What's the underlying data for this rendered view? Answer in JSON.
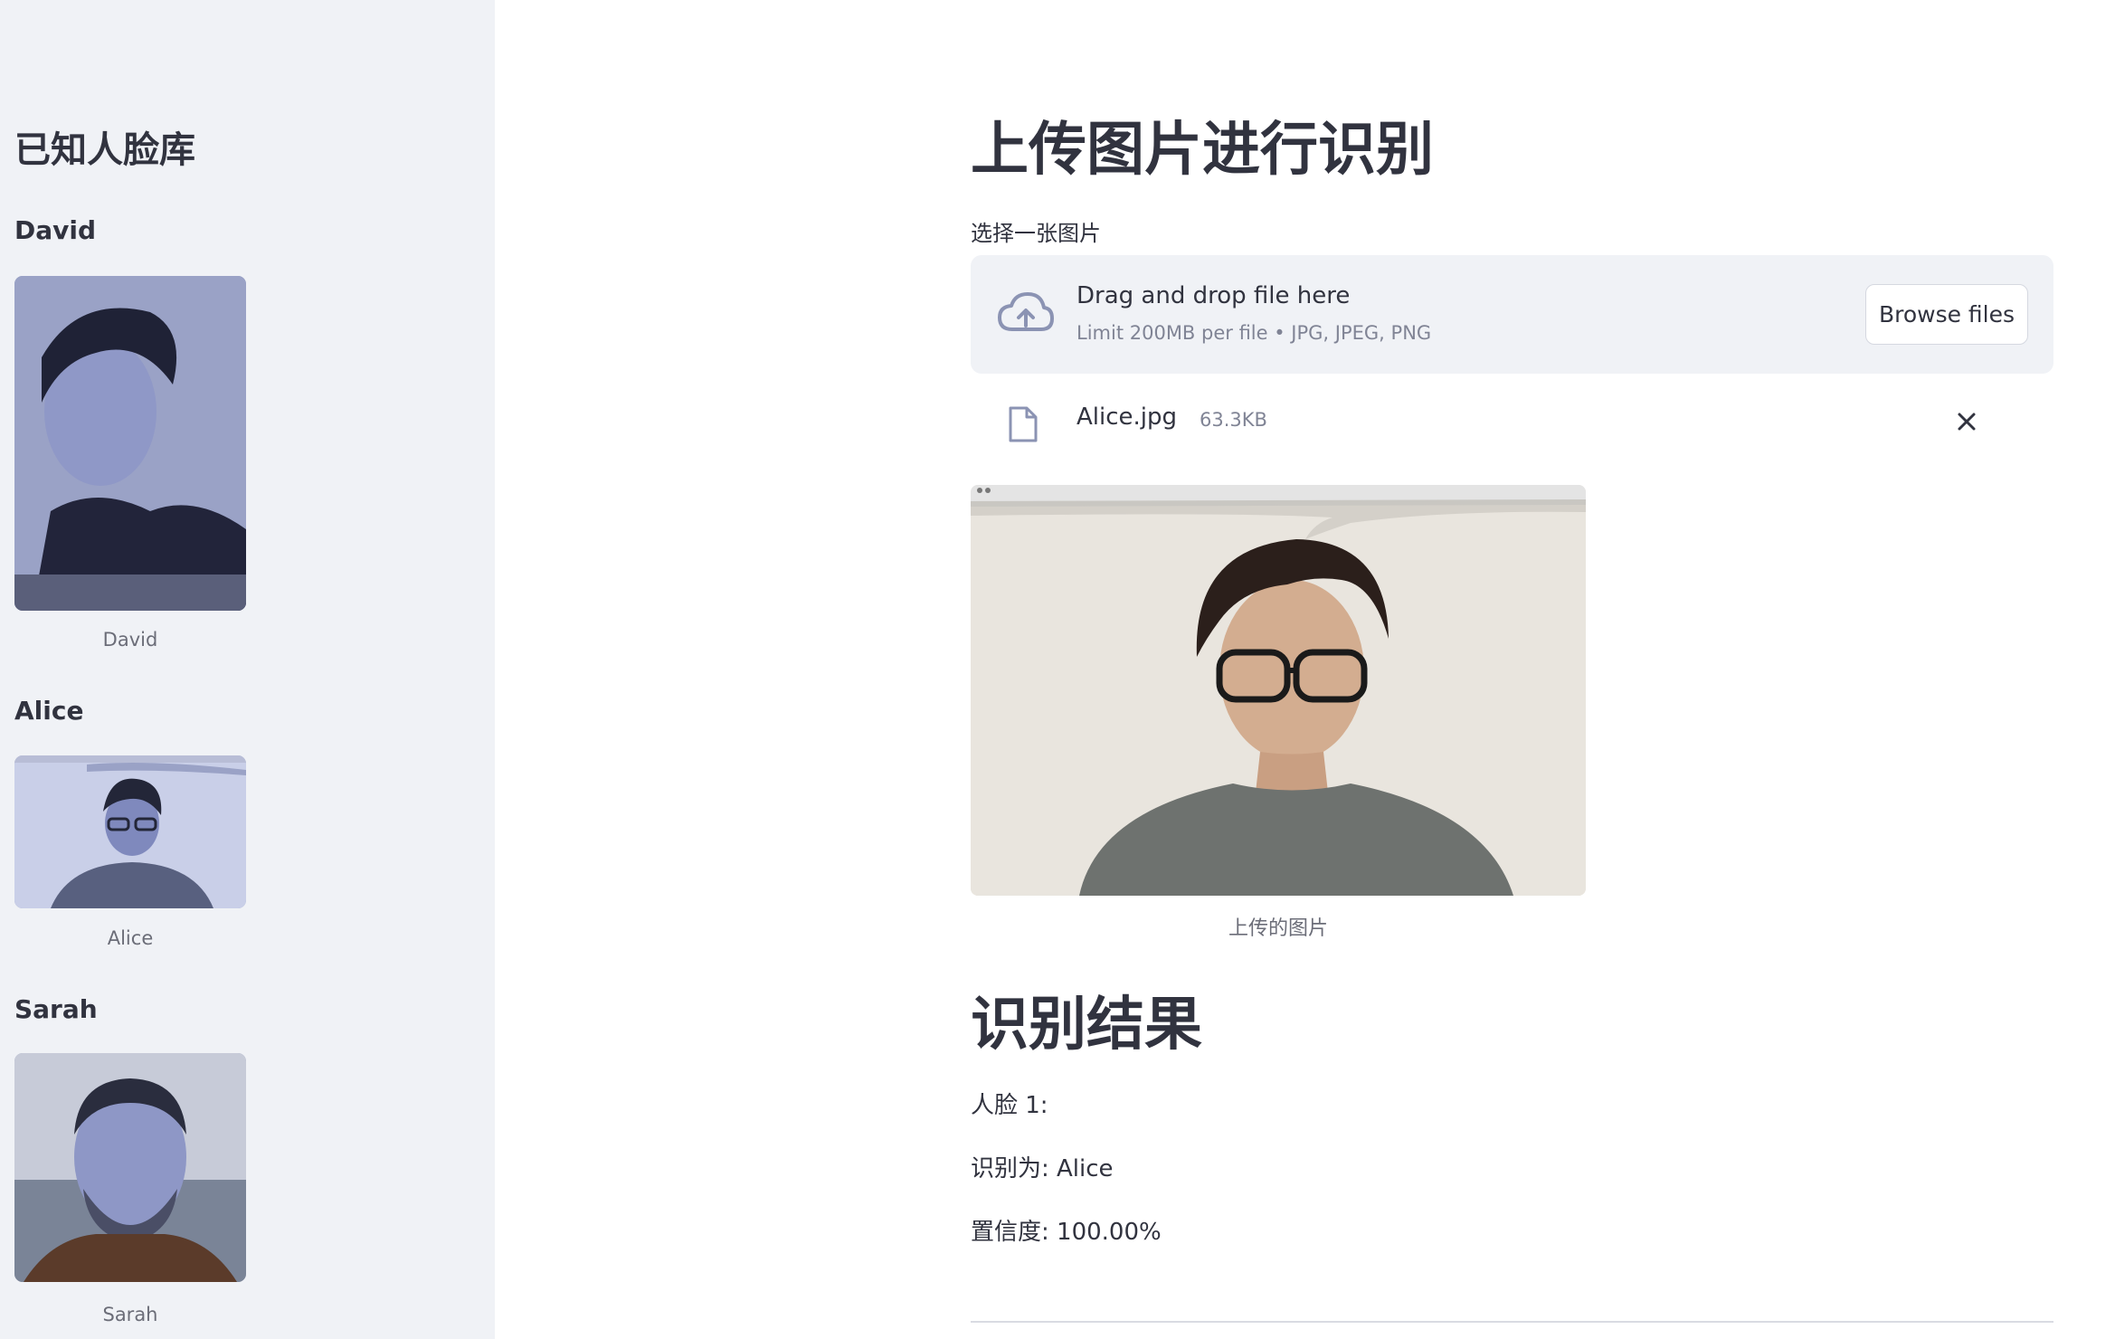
{
  "sidebar": {
    "title": "已知人脸库",
    "people": [
      {
        "name": "David",
        "caption": "David",
        "photo_icon": "portrait-photo"
      },
      {
        "name": "Alice",
        "caption": "Alice",
        "photo_icon": "portrait-photo"
      },
      {
        "name": "Sarah",
        "caption": "Sarah",
        "photo_icon": "portrait-photo"
      }
    ]
  },
  "main": {
    "title": "上传图片进行识别",
    "uploader": {
      "label": "选择一张图片",
      "drop_text": "Drag and drop file here",
      "limit_text": "Limit 200MB per file • JPG, JPEG, PNG",
      "browse_label": "Browse files",
      "icon": "cloud-upload-icon"
    },
    "file": {
      "name": "Alice.jpg",
      "size": "63.3KB",
      "icon": "file-icon",
      "remove_icon": "close-icon"
    },
    "image": {
      "caption": "上传的图片"
    },
    "results": {
      "title": "识别结果",
      "face_label": "人脸 1:",
      "identified_as": "识别为: Alice",
      "confidence": "置信度: 100.00%"
    }
  },
  "colors": {
    "sidebar_bg": "#f0f2f6",
    "text": "#31333f",
    "muted": "#808495",
    "photo_tint": "#8d97c8"
  }
}
